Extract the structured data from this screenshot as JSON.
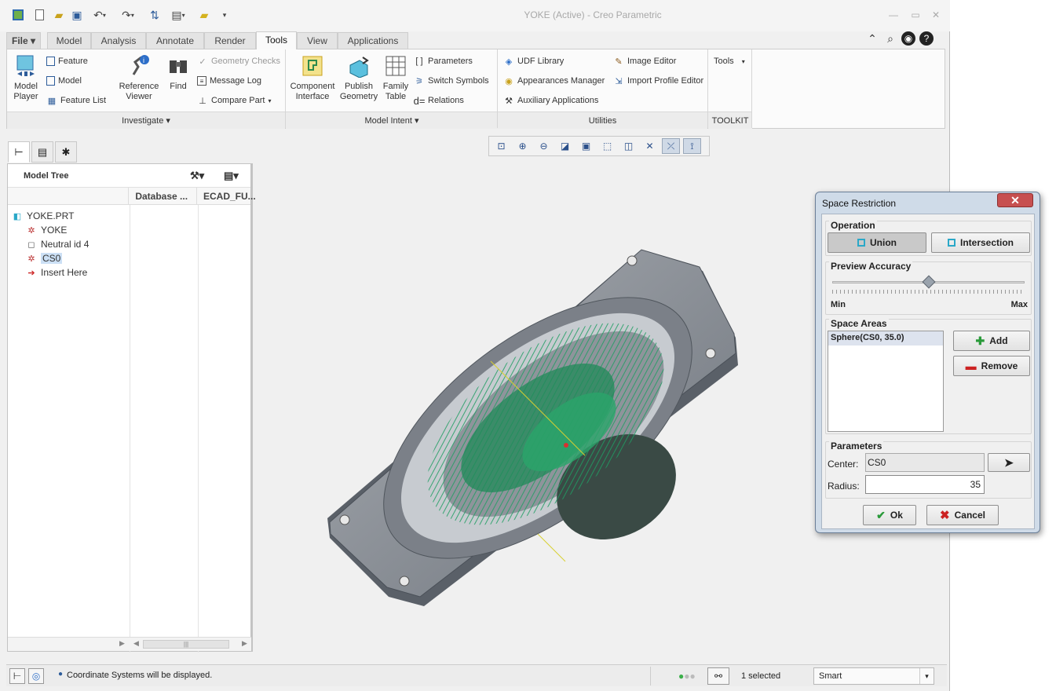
{
  "title_bar": {
    "title": "YOKE (Active) - Creo Parametric"
  },
  "quick_access": {
    "icons": [
      "app-icon",
      "new-icon",
      "open-icon",
      "save-icon",
      "undo-icon",
      "redo-icon",
      "regenerate-icon",
      "windows-icon",
      "close-window-icon",
      "customize-icon"
    ]
  },
  "ribbon_tabs": [
    {
      "label": "File ▾"
    },
    {
      "label": "Model"
    },
    {
      "label": "Analysis"
    },
    {
      "label": "Annotate"
    },
    {
      "label": "Render"
    },
    {
      "label": "Tools"
    },
    {
      "label": "View"
    },
    {
      "label": "Applications"
    }
  ],
  "ribbon": {
    "investigate": {
      "label": "Investigate ▾",
      "model_player": "Model\nPlayer",
      "feature": "Feature",
      "model": "Model",
      "feature_list": "Feature List",
      "reference_viewer": "Reference\nViewer",
      "find": "Find",
      "geometry_checks": "Geometry Checks",
      "message_log": "Message Log",
      "compare_part": "Compare Part"
    },
    "model_intent": {
      "label": "Model Intent ▾",
      "component_interface": "Component\nInterface",
      "publish_geometry": "Publish\nGeometry",
      "family_table": "Family\nTable",
      "parameters": "Parameters",
      "switch_symbols": "Switch Symbols",
      "relations": "Relations"
    },
    "utilities": {
      "label": "Utilities",
      "udf_library": "UDF Library",
      "appearances_manager": "Appearances Manager",
      "auxiliary_applications": "Auxiliary Applications",
      "image_editor": "Image Editor",
      "import_profile_editor": "Import Profile Editor"
    },
    "toolkit": {
      "label": "TOOLKIT",
      "tools": "Tools"
    }
  },
  "model_tree": {
    "title": "Model Tree",
    "columns": [
      "Database ...",
      "ECAD_FU..."
    ],
    "items": [
      {
        "label": "YOKE.PRT"
      },
      {
        "label": "YOKE"
      },
      {
        "label": "Neutral id 4"
      },
      {
        "label": "CS0"
      },
      {
        "label": "Insert Here"
      }
    ],
    "scroll_thumb": "|||"
  },
  "dialog": {
    "title": "Space Restriction",
    "operation_label": "Operation",
    "union_label": "Union",
    "intersection_label": "Intersection",
    "preview_label": "Preview Accuracy",
    "preview_value": 0.5,
    "min_label": "Min",
    "max_label": "Max",
    "space_areas_label": "Space Areas",
    "space_areas": [
      "Sphere(CS0, 35.0)"
    ],
    "add_label": "Add",
    "remove_label": "Remove",
    "parameters_label": "Parameters",
    "center_label": "Center:",
    "center_value": "CS0",
    "radius_label": "Radius:",
    "radius_value": "35",
    "ok_label": "Ok",
    "cancel_label": "Cancel"
  },
  "status_bar": {
    "message": "Coordinate Systems will be displayed.",
    "selected": "1 selected",
    "filter": "Smart"
  },
  "colors": {
    "accent": "#2d5c9a",
    "model_gray": "#8a9099",
    "mesh_green": "#1f9e62"
  }
}
